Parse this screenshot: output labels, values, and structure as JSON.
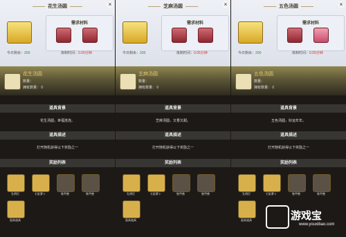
{
  "panels": [
    {
      "title": "花生汤圆",
      "rewards_box_title": "需求材料",
      "today_remaining_label": "今日剩余：",
      "today_remaining_value": "200",
      "craft_time_label": "炼制时间：",
      "craft_time_value": "0.05分钟",
      "header_name": "花生汤圆",
      "qty_label": "数量：",
      "own_label": "拥有数量： 0",
      "bg_section": "道具背景",
      "bg_text": "花生汤圆，幸福连连。",
      "desc_section": "道具描述",
      "desc_text": "打开随机获得以下奖励之一",
      "reward_section": "奖励列表",
      "reward_labels": [
        "孔明灯",
        "七彩萝卜",
        "铁甲兽",
        "铁甲兽",
        "面具道具"
      ]
    },
    {
      "title": "芝麻汤圆",
      "rewards_box_title": "需求材料",
      "today_remaining_label": "今日剩余：",
      "today_remaining_value": "200",
      "craft_time_label": "炼制时间：",
      "craft_time_value": "0.05分钟",
      "header_name": "芝麻汤圆",
      "qty_label": "数量：",
      "own_label": "拥有数量： 0",
      "bg_section": "道具背景",
      "bg_text": "芝麻汤圆，又香又甜。",
      "desc_section": "道具描述",
      "desc_text": "打开随机获得以下奖励之一",
      "reward_section": "奖励列表",
      "reward_labels": [
        "孔明灯",
        "七彩萝卜",
        "铁甲兽",
        "铁甲兽",
        "面具道具"
      ]
    },
    {
      "title": "五色汤圆",
      "rewards_box_title": "需求材料",
      "today_remaining_label": "今日剩余：",
      "today_remaining_value": "200",
      "craft_time_label": "炼制时间：",
      "craft_time_value": "0.05分钟",
      "header_name": "五色汤圆",
      "qty_label": "数量：",
      "own_label": "拥有数量： 0",
      "bg_section": "道具背景",
      "bg_text": "五色汤圆，好运年年。",
      "desc_section": "道具描述",
      "desc_text": "打开随机获得以下奖励之一",
      "reward_section": "奖励列表",
      "reward_labels": [
        "孔明灯",
        "七彩萝卜",
        "铁甲兽",
        "铁甲兽",
        "面具道具"
      ]
    }
  ],
  "watermark": {
    "text": "游戏宝",
    "url": "www.youxibao.com"
  },
  "colors": {
    "accent_gold": "#e5c46c",
    "value_green": "#2a8a3a",
    "value_red": "#cc3333"
  }
}
